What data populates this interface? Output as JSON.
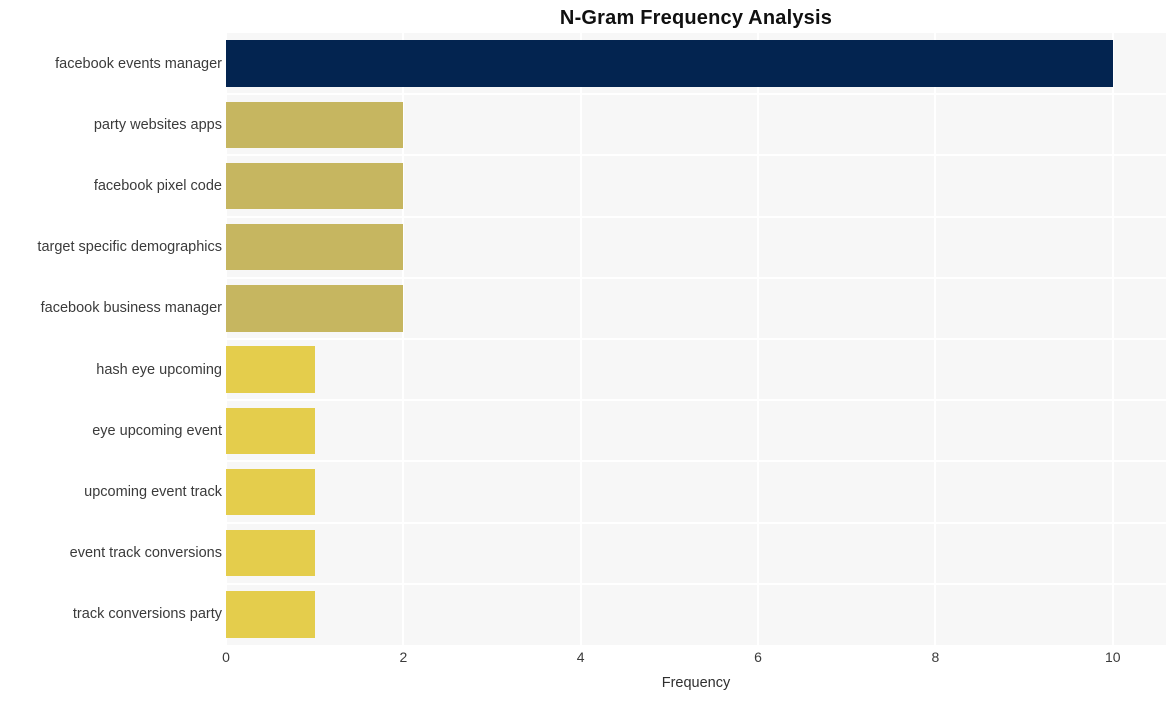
{
  "chart_data": {
    "type": "bar",
    "orientation": "horizontal",
    "title": "N-Gram Frequency Analysis",
    "xlabel": "Frequency",
    "ylabel": "",
    "xlim": [
      0,
      10.6
    ],
    "xticks": [
      0,
      2,
      4,
      6,
      8,
      10
    ],
    "xtick_labels": [
      "0",
      "2",
      "4",
      "6",
      "8",
      "10"
    ],
    "grid": true,
    "legend": "none",
    "categories": [
      "facebook events manager",
      "party websites apps",
      "facebook pixel code",
      "target specific demographics",
      "facebook business manager",
      "hash eye upcoming",
      "eye upcoming event",
      "upcoming event track",
      "event track conversions",
      "track conversions party"
    ],
    "values": [
      10,
      2,
      2,
      2,
      2,
      1,
      1,
      1,
      1,
      1
    ],
    "bar_colors": [
      "#032450",
      "#c6b660",
      "#c6b660",
      "#c6b660",
      "#c6b660",
      "#e4cd4c",
      "#e4cd4c",
      "#e4cd4c",
      "#e4cd4c",
      "#e4cd4c"
    ]
  },
  "style": {
    "page_background": "#ffffff",
    "plot_background": "#f7f7f7",
    "gridline_color": "#ffffff",
    "title_color": "#101010",
    "tick_color": "#3b3b3b"
  }
}
